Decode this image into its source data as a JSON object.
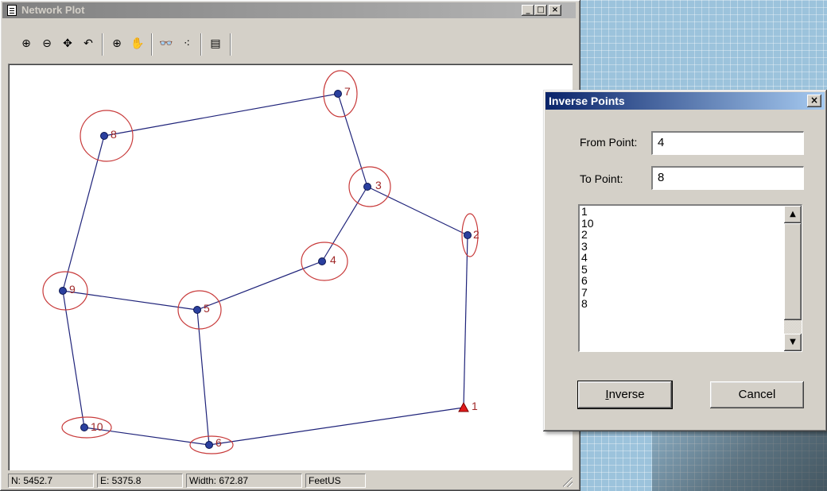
{
  "network_window": {
    "title": "Network Plot",
    "controls": {
      "minimize": "_",
      "maximize": "□",
      "close": "×"
    },
    "toolbar": [
      {
        "name": "zoom-in-icon",
        "glyph": "⊕"
      },
      {
        "name": "zoom-out-icon",
        "glyph": "⊖"
      },
      {
        "name": "pan-icon",
        "glyph": "✥"
      },
      {
        "name": "undo-zoom-icon",
        "glyph": "↶"
      },
      {
        "name": "center-icon",
        "glyph": "⊕"
      },
      {
        "name": "hand-icon",
        "glyph": "✋"
      },
      {
        "name": "binoculars-icon",
        "glyph": "👓"
      },
      {
        "name": "points-icon",
        "glyph": "⁖"
      },
      {
        "name": "notes-icon",
        "glyph": "▤"
      }
    ],
    "status": {
      "north": "N: 5452.7",
      "east": "E: 5375.8",
      "width": "Width: 672.87",
      "units": "FeetUS"
    }
  },
  "network": {
    "line_color": "#1f237a",
    "point_color": "#2a3f9e",
    "ellipse_color": "#c83a3a",
    "control_point_color": "#e01b1b",
    "points": [
      {
        "id": "1",
        "control": true
      },
      {
        "id": "2"
      },
      {
        "id": "3"
      },
      {
        "id": "4"
      },
      {
        "id": "5"
      },
      {
        "id": "6"
      },
      {
        "id": "7"
      },
      {
        "id": "8"
      },
      {
        "id": "9"
      },
      {
        "id": "10"
      }
    ],
    "connections": [
      [
        "8",
        "7"
      ],
      [
        "7",
        "3"
      ],
      [
        "3",
        "2"
      ],
      [
        "3",
        "4"
      ],
      [
        "4",
        "5"
      ],
      [
        "5",
        "9"
      ],
      [
        "9",
        "8"
      ],
      [
        "9",
        "10"
      ],
      [
        "10",
        "6"
      ],
      [
        "6",
        "1"
      ],
      [
        "1",
        "2"
      ],
      [
        "5",
        "6"
      ]
    ]
  },
  "dialog": {
    "title": "Inverse Points",
    "close": "×",
    "from_label": "From Point:",
    "from_value": "4",
    "to_label": "To Point:",
    "to_value": "8",
    "list": [
      "1",
      "10",
      "2",
      "3",
      "4",
      "5",
      "6",
      "7",
      "8"
    ],
    "inverse_button": "Inverse",
    "cancel_button": "Cancel"
  }
}
